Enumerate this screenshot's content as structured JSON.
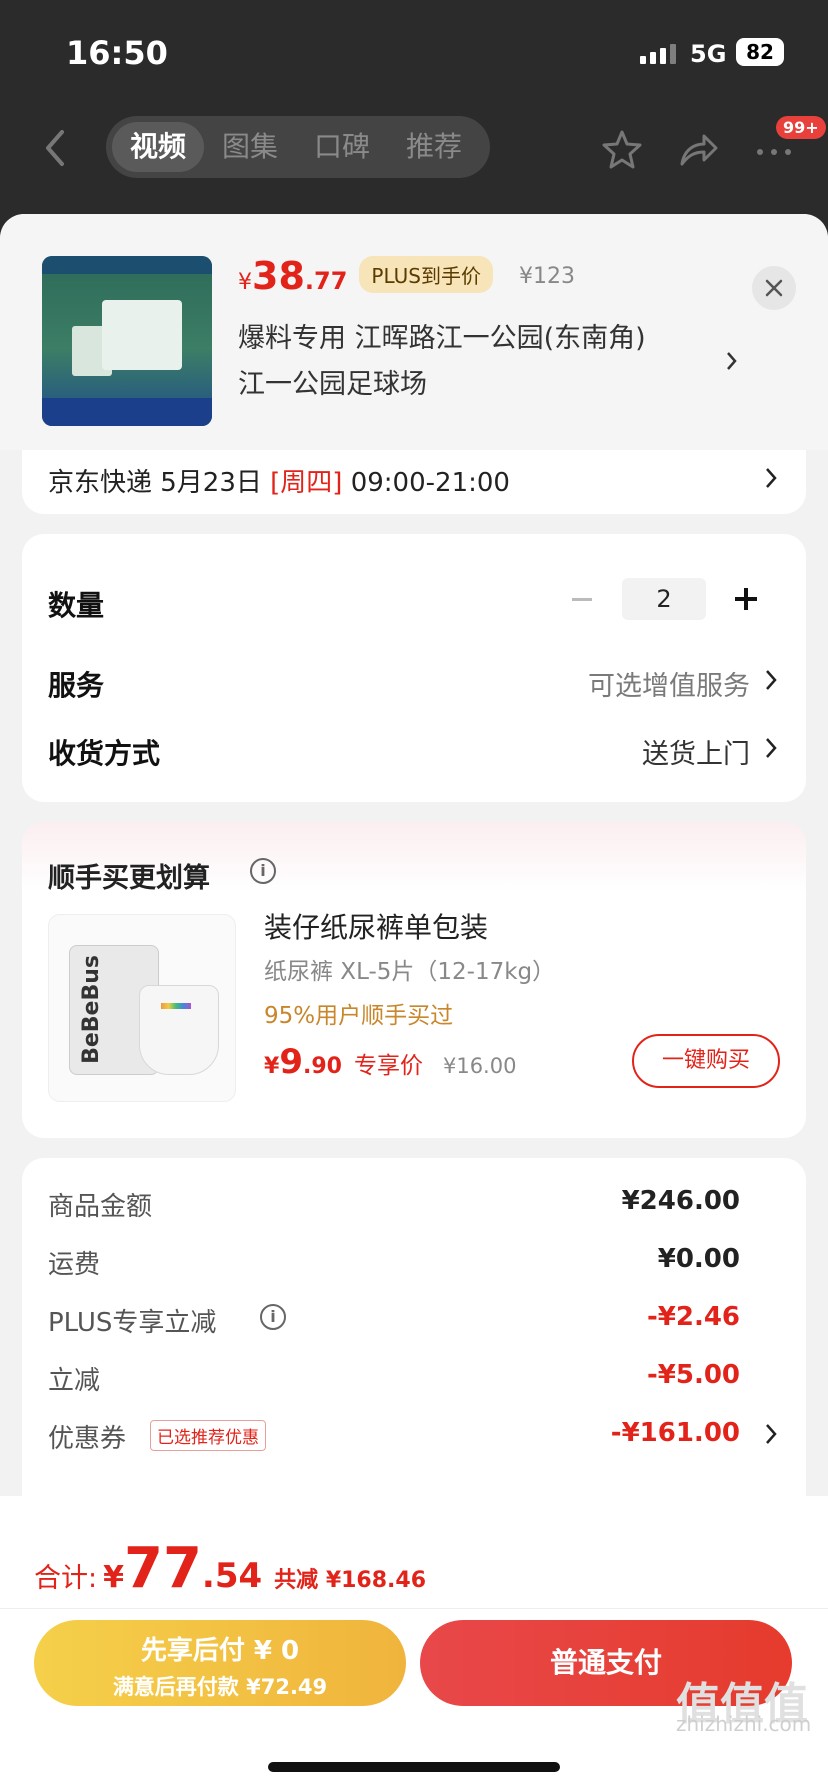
{
  "status_bar": {
    "time": "16:50",
    "network": "5G",
    "battery": "82"
  },
  "nav": {
    "tabs": [
      "视频",
      "图集",
      "口碑",
      "推荐"
    ],
    "badge": "99+"
  },
  "product": {
    "price_symbol": "¥",
    "price_int": "38",
    "price_dec": ".77",
    "plus_tag": "PLUS到手价",
    "orig_price": "¥123",
    "address_line1": "爆料专用  江晖路江一公园(东南角)",
    "address_line2": "江一公园足球场"
  },
  "delivery": {
    "prefix": "京东快递 5月23日 ",
    "weekday": "[周四]",
    "time": " 09:00-21:00"
  },
  "options": {
    "qty_label": "数量",
    "qty_value": "2",
    "service_label": "服务",
    "service_value": "可选增值服务",
    "ship_label": "收货方式",
    "ship_value": "送货上门"
  },
  "bundle": {
    "title": "顺手买更划算",
    "image_brand": "BeBeBus",
    "name": "装仔纸尿裤单包装",
    "spec": "纸尿裤 XL-5片（12-17kg）",
    "bought": "95%用户顺手买过",
    "price_symbol": "¥",
    "price_int": "9",
    "price_dec": ".90",
    "price_tag": "专享价",
    "orig_price": "¥16.00",
    "buy_label": "一键购买"
  },
  "summary": {
    "rows": [
      {
        "label": "商品金额",
        "value": "¥246.00"
      },
      {
        "label": "运费",
        "value": "¥0.00"
      },
      {
        "label": "PLUS专享立减",
        "value": "-¥2.46"
      },
      {
        "label": "立减",
        "value": "-¥5.00"
      },
      {
        "label": "优惠券",
        "value": "-¥161.00"
      }
    ],
    "coupon_tag": "已选推荐优惠"
  },
  "footer": {
    "total_label": "合计:",
    "total_symbol": "¥",
    "total_int": "77",
    "total_dec": ".54",
    "total_saving": "共减 ¥168.46",
    "pay_later_line1": "先享后付 ¥ 0",
    "pay_later_line2": "满意后再付款 ¥72.49",
    "pay_normal": "普通支付",
    "watermark_big": "值值值",
    "watermark": "zhizhizhi.com"
  },
  "colors": {
    "accent": "#e2231a",
    "plus_gold": "#f7e4b8",
    "pay_later": "#f0b43c"
  }
}
